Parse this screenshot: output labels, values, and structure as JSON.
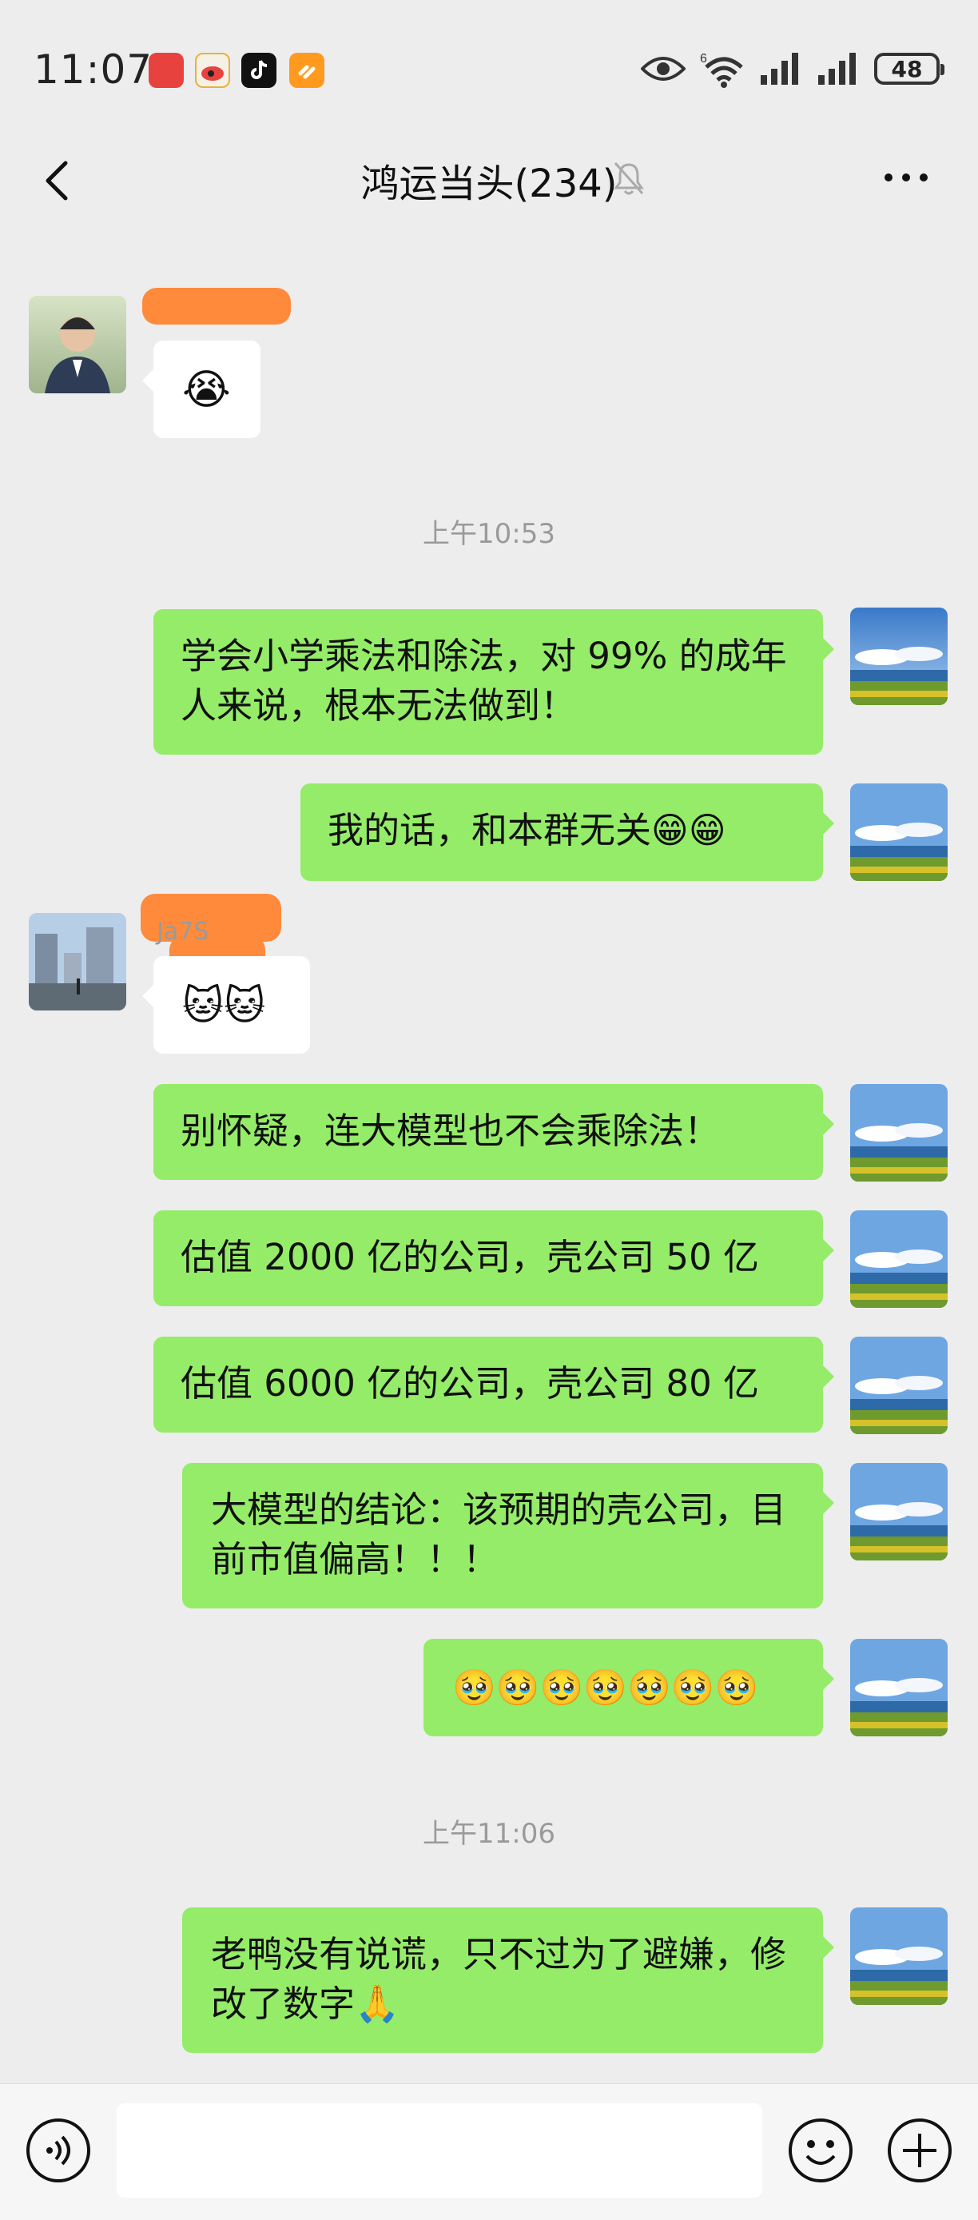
{
  "status_bar": {
    "time": "11:07",
    "battery": "48",
    "network_label": "6"
  },
  "header": {
    "title": "鸿运当头(234)",
    "icons": [
      "back-icon",
      "mute-bell-icon",
      "more-icon"
    ]
  },
  "messages": {
    "m0_emoji": "😭",
    "stamp1": "上午10:53",
    "m1": "学会小学乘法和除法，对 99% 的成年人来说，根本无法做到！",
    "m1_emoji": "🙏",
    "m2": "我的话，和本群无关😁😁",
    "m3_emoji": "🐱🐱",
    "m3_name_fragment": "Ja7S",
    "m4": "别怀疑，连大模型也不会乘除法！",
    "m5": "估值 2000 亿的公司，壳公司 50 亿",
    "m6": "估值 6000 亿的公司，壳公司 80 亿",
    "m7": "大模型的结论：该预期的壳公司，目前市值偏高！！！",
    "m8": "🥹🥹🥹🥹🥹🥹🥹",
    "stamp2": "上午11:06",
    "m9": "老鸭没有说谎，只不过为了避嫌，修改了数字🙏"
  },
  "input_bar": {
    "icons": [
      "voice-icon",
      "emoji-icon",
      "plus-icon"
    ]
  }
}
